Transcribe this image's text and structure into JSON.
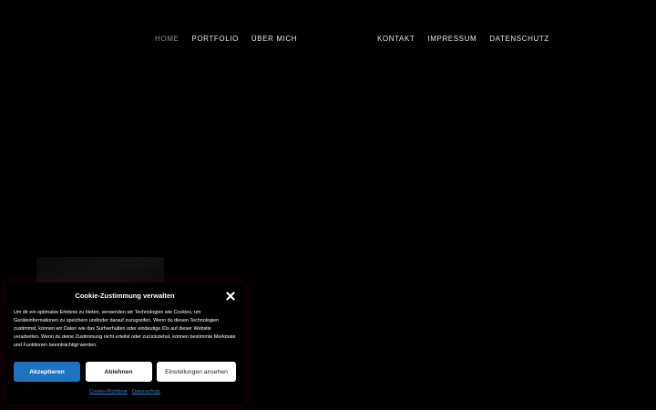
{
  "nav": {
    "left_items": [
      {
        "label": "HOME",
        "active": true
      },
      {
        "label": "PORTFOLIO",
        "active": false
      },
      {
        "label": "ÜBER MICH",
        "active": false
      }
    ],
    "right_items": [
      {
        "label": "KONTAKT",
        "active": false
      },
      {
        "label": "IMPRESSUM",
        "active": false
      },
      {
        "label": "DATENSCHUTZ",
        "active": false
      }
    ]
  },
  "cookie_banner": {
    "title": "Cookie-Zustimmung verwalten",
    "close_icon": "close-icon",
    "text": "Um dir ein optimales Erlebnis zu bieten, verwenden wir Technologien wie Cookies, um Geräteinformationen zu speichern und/oder darauf zuzugreifen. Wenn du diesen Technologien zustimmst, können wir Daten wie das Surfverhalten oder eindeutige IDs auf dieser Website verarbeiten. Wenn du deine Zustimmung nicht erteilst oder zurückziehst, können bestimmte Merkmale und Funktionen beeinträchtigt werden.",
    "buttons": {
      "accept": "Akzeptieren",
      "deny": "Ablehnen",
      "settings": "Einstellungen ansehen"
    },
    "links": {
      "cookie_policy": "Cookie-Richtlinie",
      "privacy": "Datenschutz"
    }
  },
  "colors": {
    "background": "#000000",
    "accent_blue": "#1e73be",
    "nav_active": "#8a8a8a",
    "nav_text": "#e6e6e6"
  }
}
